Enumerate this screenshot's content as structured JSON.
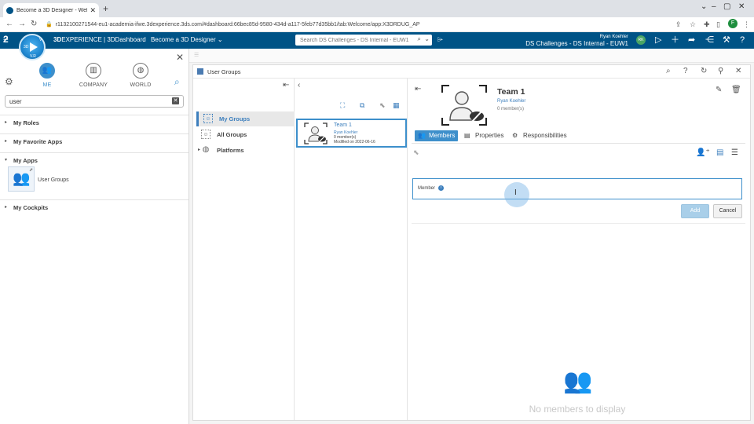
{
  "browser": {
    "tab_title": "Become a 3D Designer - Welcome",
    "url": "r1132100271544-eu1-academia-ifwe.3dexperience.3ds.com/#dashboard:66bec85d-9580-434d-a117-5feb77d35bb1/tab:Welcome/app:X3DRDUG_AP",
    "profile_initial": "F"
  },
  "topbar": {
    "brand_bold": "3D",
    "brand_rest": "EXPERIENCE | 3DDashboard",
    "dashboard_name": "Become a 3D Designer",
    "search_placeholder": "Search DS Challenges - DS Internal - EUW1",
    "user_name": "Ryan Koehler",
    "tenant": "DS Challenges - DS Internal - EUW1",
    "avatar_initials": "RK"
  },
  "left_panel": {
    "tabs": [
      {
        "label": "ME",
        "active": true
      },
      {
        "label": "COMPANY",
        "active": false
      },
      {
        "label": "WORLD",
        "active": false
      }
    ],
    "filter_value": "user",
    "sections": {
      "roles": "My Roles",
      "favorites": "My Favorite Apps",
      "apps": "My Apps",
      "cockpits": "My Cockpits"
    },
    "app_label": "User Groups"
  },
  "widget": {
    "title": "User Groups",
    "nav": {
      "my_groups": "My Groups",
      "all_groups": "All Groups",
      "platforms": "Platforms"
    },
    "card": {
      "title": "Team 1",
      "owner": "Ryan Koehler",
      "members": "0 member(s)",
      "modified": "Modified on 2022-06-16"
    },
    "detail": {
      "title": "Team 1",
      "owner": "Ryan Koehler",
      "member_count": "0 member(s)",
      "tabs": {
        "members": "Members",
        "properties": "Properties",
        "responsibilities": "Responsibilities"
      },
      "member_label": "Member",
      "add_label": "Add",
      "cancel_label": "Cancel",
      "empty_text": "No members to display"
    }
  },
  "colors": {
    "accent": "#3d8fcb",
    "topbar": "#005386"
  }
}
